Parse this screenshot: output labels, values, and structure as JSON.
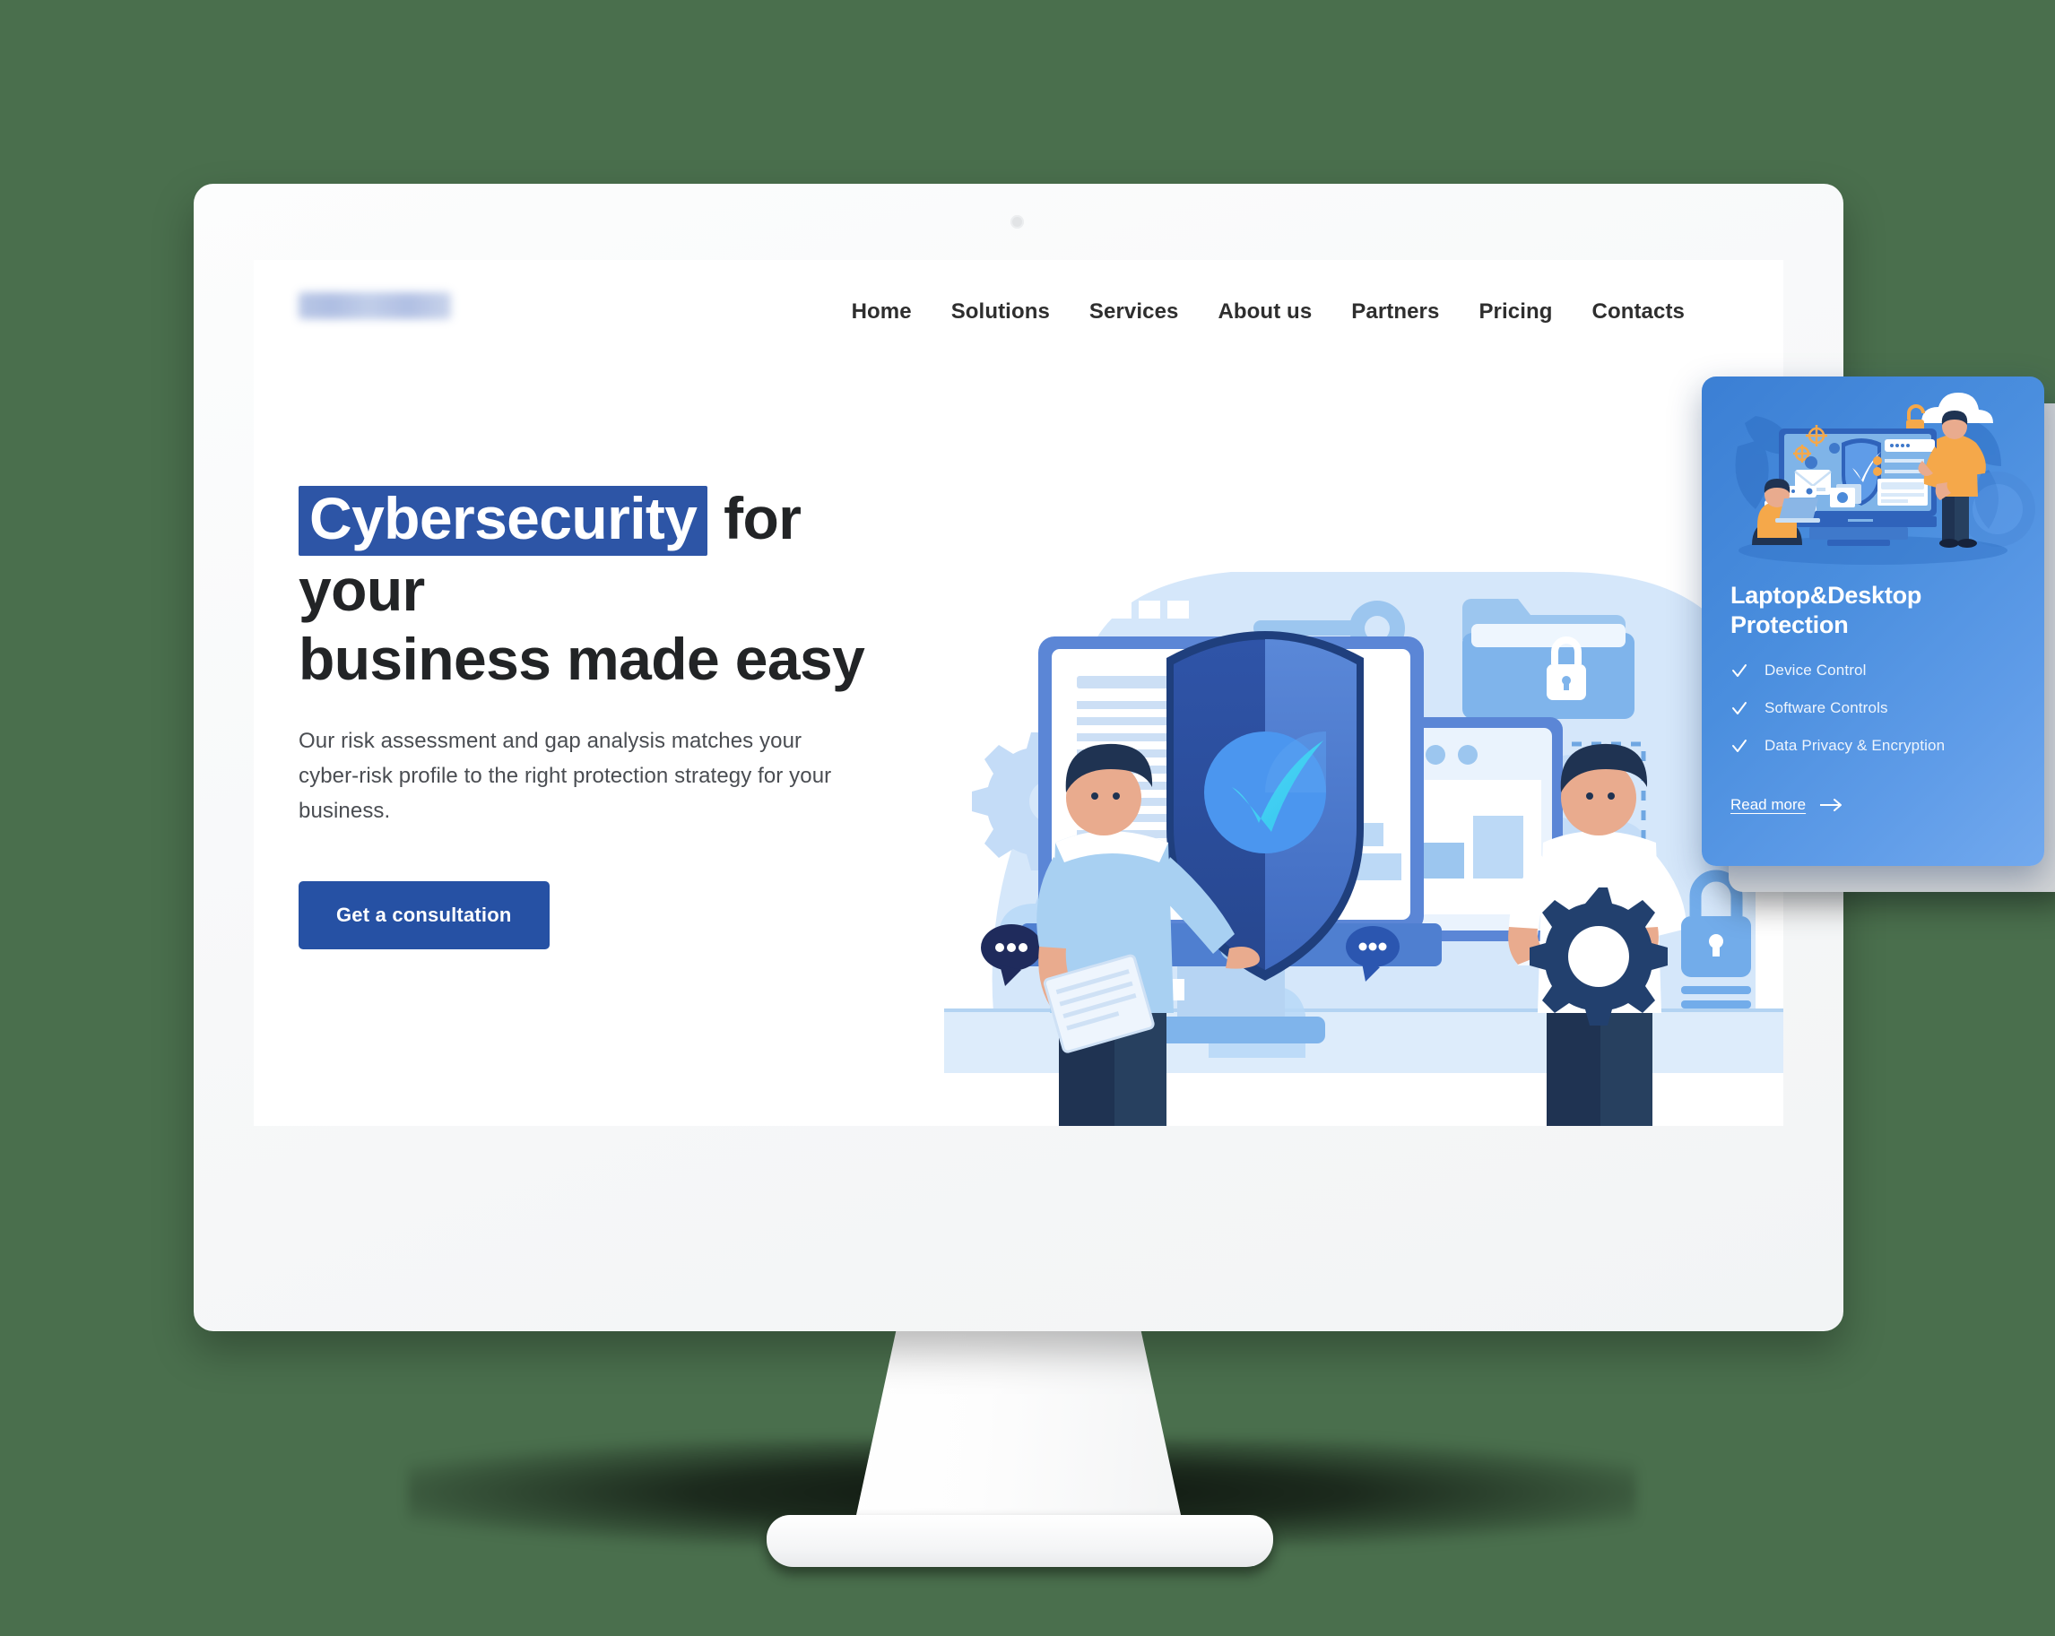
{
  "page": {
    "background_color": "#4a6f4d",
    "device": "desktop-monitor-mockup"
  },
  "site": {
    "logo_alt": "company-logo-blurred",
    "accent_color": "#2651a4",
    "highlight_color": "#2d55a6",
    "nav": {
      "items": [
        {
          "label": "Home"
        },
        {
          "label": "Solutions"
        },
        {
          "label": "Services"
        },
        {
          "label": "About us"
        },
        {
          "label": "Partners"
        },
        {
          "label": "Pricing"
        },
        {
          "label": "Contacts"
        }
      ]
    },
    "hero": {
      "title_highlight": "Cybersecurity",
      "title_rest_line1": "for your",
      "title_line2": "business made easy",
      "subtitle": "Our risk assessment and gap analysis matches your cyber-risk profile to the right protection strategy for your business.",
      "cta_label": "Get a consultation",
      "illustration_alt": "cybersecurity-shield-monitor-people-illustration"
    }
  },
  "feature_card": {
    "title": "Laptop&Desktop Protection",
    "illustration_alt": "device-protection-illustration",
    "gradient_from": "#3b7fd4",
    "gradient_to": "#72a9ee",
    "features": [
      {
        "label": "Device Control"
      },
      {
        "label": "Software Controls"
      },
      {
        "label": "Data Privacy & Encryption"
      }
    ],
    "read_more_label": "Read more"
  }
}
